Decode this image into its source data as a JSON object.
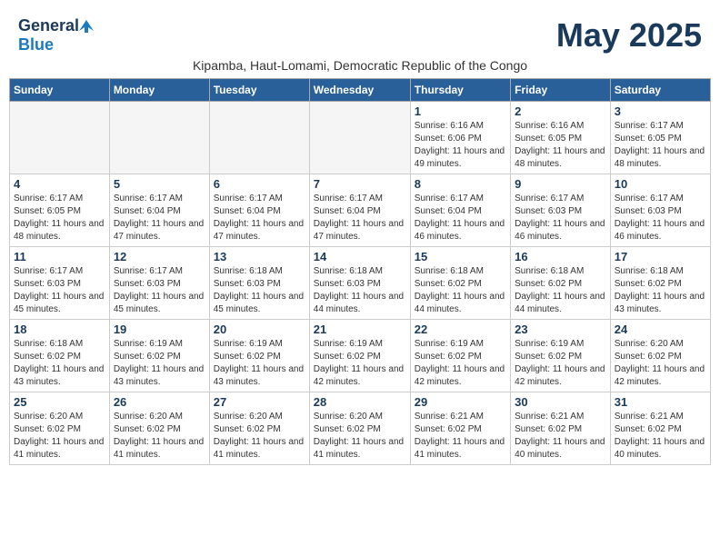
{
  "logo": {
    "general": "General",
    "blue": "Blue"
  },
  "title": "May 2025",
  "subtitle": "Kipamba, Haut-Lomami, Democratic Republic of the Congo",
  "days_of_week": [
    "Sunday",
    "Monday",
    "Tuesday",
    "Wednesday",
    "Thursday",
    "Friday",
    "Saturday"
  ],
  "weeks": [
    [
      {
        "day": "",
        "info": ""
      },
      {
        "day": "",
        "info": ""
      },
      {
        "day": "",
        "info": ""
      },
      {
        "day": "",
        "info": ""
      },
      {
        "day": "1",
        "info": "Sunrise: 6:16 AM\nSunset: 6:06 PM\nDaylight: 11 hours and 49 minutes."
      },
      {
        "day": "2",
        "info": "Sunrise: 6:16 AM\nSunset: 6:05 PM\nDaylight: 11 hours and 48 minutes."
      },
      {
        "day": "3",
        "info": "Sunrise: 6:17 AM\nSunset: 6:05 PM\nDaylight: 11 hours and 48 minutes."
      }
    ],
    [
      {
        "day": "4",
        "info": "Sunrise: 6:17 AM\nSunset: 6:05 PM\nDaylight: 11 hours and 48 minutes."
      },
      {
        "day": "5",
        "info": "Sunrise: 6:17 AM\nSunset: 6:04 PM\nDaylight: 11 hours and 47 minutes."
      },
      {
        "day": "6",
        "info": "Sunrise: 6:17 AM\nSunset: 6:04 PM\nDaylight: 11 hours and 47 minutes."
      },
      {
        "day": "7",
        "info": "Sunrise: 6:17 AM\nSunset: 6:04 PM\nDaylight: 11 hours and 47 minutes."
      },
      {
        "day": "8",
        "info": "Sunrise: 6:17 AM\nSunset: 6:04 PM\nDaylight: 11 hours and 46 minutes."
      },
      {
        "day": "9",
        "info": "Sunrise: 6:17 AM\nSunset: 6:03 PM\nDaylight: 11 hours and 46 minutes."
      },
      {
        "day": "10",
        "info": "Sunrise: 6:17 AM\nSunset: 6:03 PM\nDaylight: 11 hours and 46 minutes."
      }
    ],
    [
      {
        "day": "11",
        "info": "Sunrise: 6:17 AM\nSunset: 6:03 PM\nDaylight: 11 hours and 45 minutes."
      },
      {
        "day": "12",
        "info": "Sunrise: 6:17 AM\nSunset: 6:03 PM\nDaylight: 11 hours and 45 minutes."
      },
      {
        "day": "13",
        "info": "Sunrise: 6:18 AM\nSunset: 6:03 PM\nDaylight: 11 hours and 45 minutes."
      },
      {
        "day": "14",
        "info": "Sunrise: 6:18 AM\nSunset: 6:03 PM\nDaylight: 11 hours and 44 minutes."
      },
      {
        "day": "15",
        "info": "Sunrise: 6:18 AM\nSunset: 6:02 PM\nDaylight: 11 hours and 44 minutes."
      },
      {
        "day": "16",
        "info": "Sunrise: 6:18 AM\nSunset: 6:02 PM\nDaylight: 11 hours and 44 minutes."
      },
      {
        "day": "17",
        "info": "Sunrise: 6:18 AM\nSunset: 6:02 PM\nDaylight: 11 hours and 43 minutes."
      }
    ],
    [
      {
        "day": "18",
        "info": "Sunrise: 6:18 AM\nSunset: 6:02 PM\nDaylight: 11 hours and 43 minutes."
      },
      {
        "day": "19",
        "info": "Sunrise: 6:19 AM\nSunset: 6:02 PM\nDaylight: 11 hours and 43 minutes."
      },
      {
        "day": "20",
        "info": "Sunrise: 6:19 AM\nSunset: 6:02 PM\nDaylight: 11 hours and 43 minutes."
      },
      {
        "day": "21",
        "info": "Sunrise: 6:19 AM\nSunset: 6:02 PM\nDaylight: 11 hours and 42 minutes."
      },
      {
        "day": "22",
        "info": "Sunrise: 6:19 AM\nSunset: 6:02 PM\nDaylight: 11 hours and 42 minutes."
      },
      {
        "day": "23",
        "info": "Sunrise: 6:19 AM\nSunset: 6:02 PM\nDaylight: 11 hours and 42 minutes."
      },
      {
        "day": "24",
        "info": "Sunrise: 6:20 AM\nSunset: 6:02 PM\nDaylight: 11 hours and 42 minutes."
      }
    ],
    [
      {
        "day": "25",
        "info": "Sunrise: 6:20 AM\nSunset: 6:02 PM\nDaylight: 11 hours and 41 minutes."
      },
      {
        "day": "26",
        "info": "Sunrise: 6:20 AM\nSunset: 6:02 PM\nDaylight: 11 hours and 41 minutes."
      },
      {
        "day": "27",
        "info": "Sunrise: 6:20 AM\nSunset: 6:02 PM\nDaylight: 11 hours and 41 minutes."
      },
      {
        "day": "28",
        "info": "Sunrise: 6:20 AM\nSunset: 6:02 PM\nDaylight: 11 hours and 41 minutes."
      },
      {
        "day": "29",
        "info": "Sunrise: 6:21 AM\nSunset: 6:02 PM\nDaylight: 11 hours and 41 minutes."
      },
      {
        "day": "30",
        "info": "Sunrise: 6:21 AM\nSunset: 6:02 PM\nDaylight: 11 hours and 40 minutes."
      },
      {
        "day": "31",
        "info": "Sunrise: 6:21 AM\nSunset: 6:02 PM\nDaylight: 11 hours and 40 minutes."
      }
    ]
  ]
}
